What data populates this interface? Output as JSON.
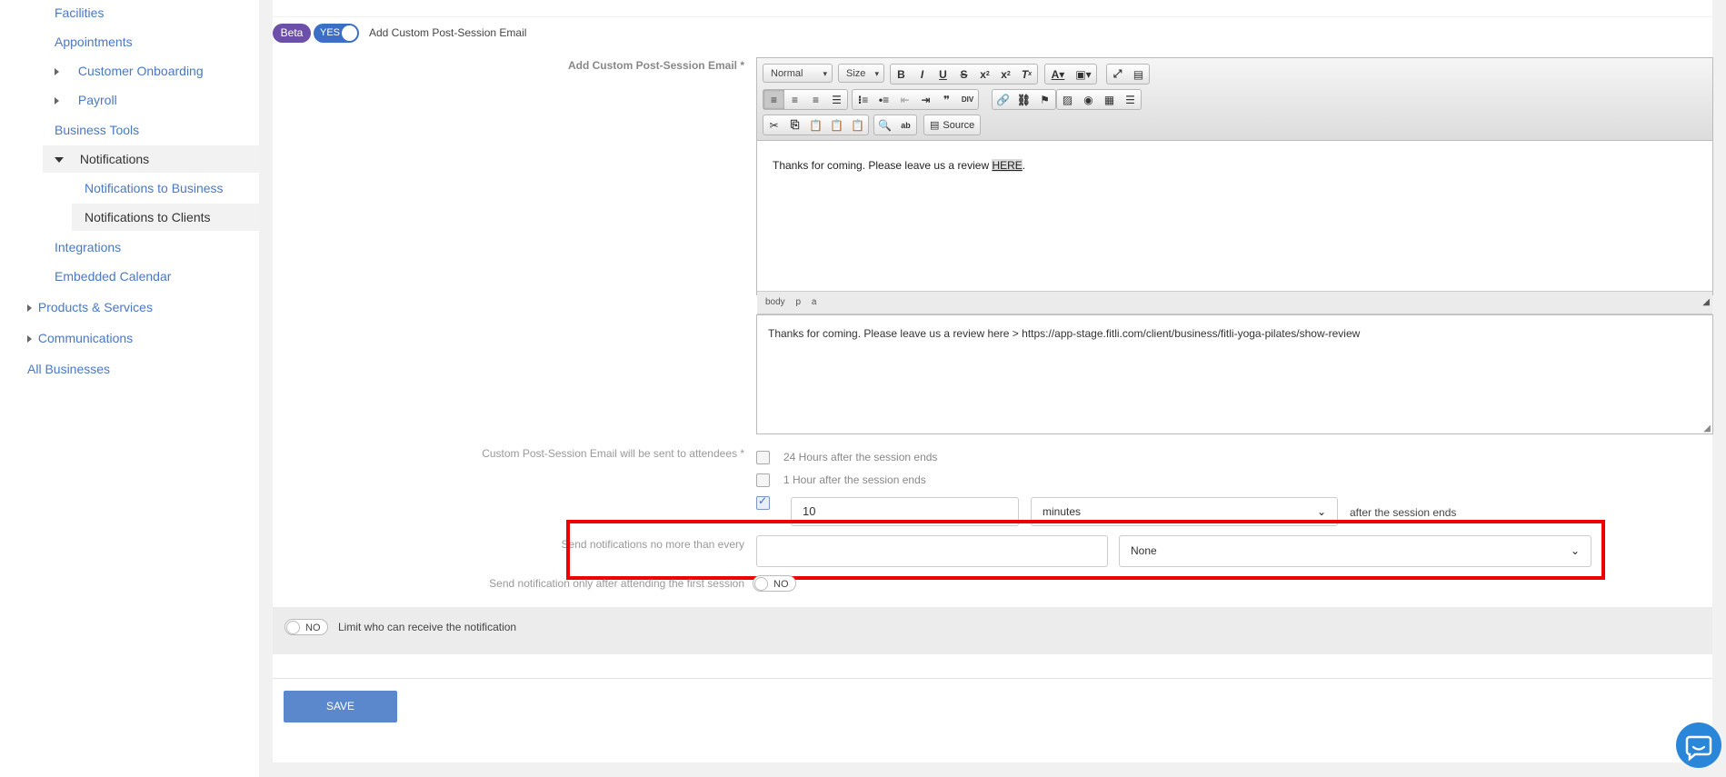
{
  "sidebar": {
    "items": [
      {
        "label": "Facilities"
      },
      {
        "label": "Appointments"
      },
      {
        "label": "Customer Onboarding"
      },
      {
        "label": "Payroll"
      },
      {
        "label": "Business Tools"
      },
      {
        "label": "Notifications"
      },
      {
        "label": "Notifications to Business"
      },
      {
        "label": "Notifications to Clients"
      },
      {
        "label": "Integrations"
      },
      {
        "label": "Embedded Calendar"
      },
      {
        "label": "Products & Services"
      },
      {
        "label": "Communications"
      },
      {
        "label": "All Businesses"
      }
    ]
  },
  "header": {
    "beta_badge": "Beta",
    "toggle_label": "YES",
    "title": "Add Custom Post-Session Email"
  },
  "editor": {
    "field_label": "Add Custom Post-Session Email *",
    "format_combo": "Normal",
    "size_combo": "Size",
    "source_button": "Source",
    "content_text": "Thanks for coming. Please leave us a review ",
    "content_link": "HERE",
    "content_after": ".",
    "path": [
      "body",
      "p",
      "a"
    ]
  },
  "plain_text": "Thanks for coming. Please leave us a review here > https://app-stage.fitli.com/client/business/fitli-yoga-pilates/show-review",
  "send_options": {
    "label": "Custom Post-Session Email will be sent to attendees *",
    "opt1": "24 Hours after the session ends",
    "opt2": "1 Hour after the session ends",
    "custom_value": "10",
    "custom_unit": "minutes",
    "custom_suffix": "after the session ends"
  },
  "frequency": {
    "label": "Send notifications no more than every",
    "value": "",
    "unit": "None"
  },
  "first_session": {
    "label": "Send notification only after attending the first session",
    "toggle": "NO"
  },
  "limit": {
    "toggle": "NO",
    "label": "Limit who can receive the notification"
  },
  "save_label": "SAVE",
  "colors": {
    "accent": "#3b6fc6",
    "beta": "#6c4fa8",
    "highlight": "#e00000"
  }
}
